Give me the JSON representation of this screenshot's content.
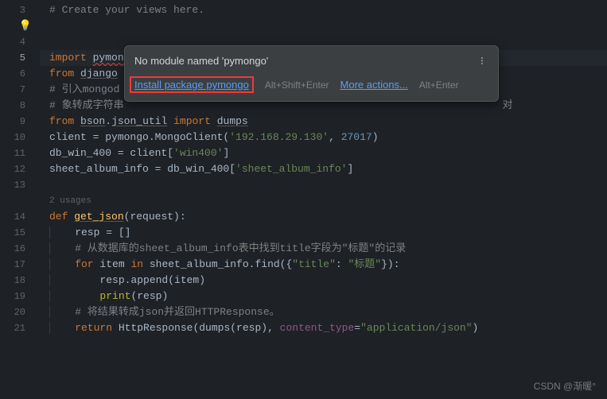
{
  "gutter": {
    "lines": [
      "3",
      "",
      "4",
      "5",
      "6",
      "7",
      "8",
      "9",
      "10",
      "11",
      "12",
      "13",
      "",
      "14",
      "15",
      "16",
      "17",
      "18",
      "19",
      "20",
      "21"
    ],
    "active_index": 3,
    "bulb_glyph": "💡"
  },
  "code": {
    "l3_comment": "# Create your views here.",
    "l5_import": "import",
    "l5_pymongo": "pymongo",
    "l6_from": "from",
    "l6_django": "django",
    "l7_comment": "# 引入mongod",
    "l8_comment": "# 象转成字符串",
    "l8_tail": "对",
    "l9_from": "from",
    "l9_bson": "bson",
    "l9_dot": ".",
    "l9_json_util": "json_util",
    "l9_import": "import",
    "l9_dumps": "dumps",
    "l10_a": "client = pymongo.MongoClient(",
    "l10_ip": "'192.168.29.130'",
    "l10_c": ", ",
    "l10_port": "27017",
    "l10_e": ")",
    "l11_a": "db_win_400 = client[",
    "l11_b": "'win400'",
    "l11_c": "]",
    "l12_a": "sheet_album_info = db_win_400[",
    "l12_b": "'sheet_album_info'",
    "l12_c": "]",
    "usages": "2 usages",
    "l14_def": "def ",
    "l14_name": "get_json",
    "l14_p": "(request):",
    "l15": "    resp = []",
    "l16": "    # 从数据库的sheet_album_info表中找到title字段为\"标题\"的记录",
    "l17_for": "    for ",
    "l17_item": "item ",
    "l17_in": "in ",
    "l17_call": "sheet_album_info.find({",
    "l17_key": "\"title\"",
    "l17_colon": ": ",
    "l17_val": "\"标题\"",
    "l17_end": "}):",
    "l18_a": "        resp.append(item)",
    "l19_a": "        ",
    "l19_print": "print",
    "l19_b": "(resp)",
    "l20": "    # 将结果转成json并返回HTTPResponse。",
    "l21_ret": "    return ",
    "l21_fn": "HttpResponse",
    "l21_a": "(dumps(resp), ",
    "l21_kw": "content_type",
    "l21_eq": "=",
    "l21_val": "\"application/json\"",
    "l21_end": ")"
  },
  "tooltip": {
    "message": "No module named 'pymongo'",
    "install": "Install package pymongo",
    "install_hint": "Alt+Shift+Enter",
    "more": "More actions...",
    "more_hint": "Alt+Enter",
    "menu_glyph": "..."
  },
  "watermark": "CSDN @渐暖°",
  "chart_data": null
}
